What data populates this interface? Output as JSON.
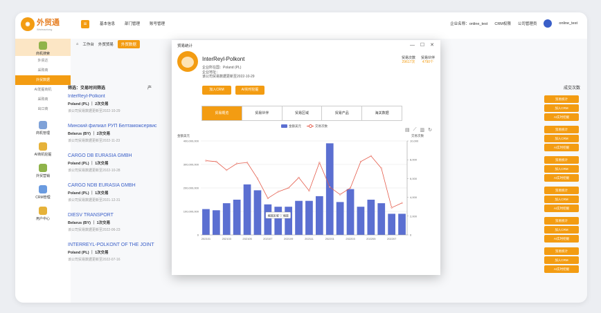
{
  "app": {
    "logo_text": "外贸通",
    "logo_sub": "Waimaotong",
    "menu_icon": "hamburger-icon",
    "topnav": [
      "基本信息",
      "部门管理",
      "账号管理"
    ],
    "company_label": "企业名称：online_test",
    "crm_label": "CRM权限",
    "manager_label": "公司管理员",
    "username": "online_test"
  },
  "sidebar": {
    "groups": [
      {
        "label": "商机搜索",
        "items": [
          "外贸达",
          "采购商",
          "外贸数据",
          "AI发掘商机",
          "采购商",
          "出口商"
        ]
      },
      {
        "label": "商机管理",
        "items": []
      },
      {
        "label": "AI商机挖掘",
        "items": []
      },
      {
        "label": "外贸营销",
        "items": []
      },
      {
        "label": "CRM管理",
        "items": []
      },
      {
        "label": "用户中心",
        "items": []
      }
    ]
  },
  "tabs": [
    "工作台",
    "外贸贸易",
    "外贸数据"
  ],
  "filter": {
    "label": "筛选：交易时间筛选",
    "label2": "产"
  },
  "companies": [
    {
      "name": "InterReyl-Polkont",
      "country": "Poland (PL) ｜ 2次交易",
      "date": "该公司贸易数据更新至2022-10-29"
    },
    {
      "name": "Минский филиал РУП Белтаможсервис",
      "country": "Belarus (BY) ｜ 2次交易",
      "date": "该公司贸易数据更新至2022-11-23"
    },
    {
      "name": "CARGO DB EURASIA GMBH",
      "country": "Poland (PL) ｜ 1次交易",
      "date": "该公司贸易数据更新至2022-10-28"
    },
    {
      "name": "CARGO NDB EURASIA GMBH",
      "country": "Poland (PL) ｜ 1次交易",
      "date": "该公司贸易数据更新至2021-12-31"
    },
    {
      "name": "DIESV TRANSPORT",
      "country": "Belarus (BY) ｜ 1次交易",
      "date": "该公司贸易数据更新至2022-06-23"
    },
    {
      "name": "INTERREYL-POLKONT OF THE JOINT",
      "country": "Poland (PL) ｜ 1次交易",
      "date": "该公司贸易数据更新至2022-07-16"
    }
  ],
  "right_header": "成交次数",
  "actions": [
    "贸易统计",
    "加入CRM",
    "AI实时挖掘"
  ],
  "modal": {
    "title": "贸易统计",
    "controls": "— ☐ ✕",
    "company": "InterReyl-Polkont",
    "info": [
      "企业所在国：Poland (PL)",
      "企业地址：",
      "该公司贸易数据更新至2022-10-29"
    ],
    "btn_crm": "加入CRM",
    "btn_ai": "AI实时挖掘",
    "stat1_label": "贸易次数",
    "stat1_value": "29617次",
    "stat2_label": "贸易伙伴",
    "stat2_value": "4790个",
    "tabs": [
      "贸易概览",
      "贸易伙伴",
      "贸易区域",
      "贸易产品",
      "海关数据"
    ]
  },
  "chart_data": {
    "type": "bar",
    "legend": [
      "金额美元",
      "交易次数"
    ],
    "ylabel_left": "金额美元",
    "ylabel_right": "交易次数",
    "x": [
      "202101",
      "202102",
      "202103",
      "202104",
      "202105",
      "202106",
      "202107",
      "202108",
      "202109",
      "202110",
      "202111",
      "202112",
      "202201",
      "202202",
      "202203",
      "202204",
      "202205",
      "202206",
      "202207",
      "202208"
    ],
    "x_labels": [
      "202101",
      "202103",
      "202105",
      "202107",
      "202109",
      "202111",
      "202201",
      "202203",
      "202205",
      "202207"
    ],
    "bars": [
      110000000,
      105000000,
      135000000,
      150000000,
      215000000,
      190000000,
      130000000,
      120000000,
      120000000,
      145000000,
      145000000,
      165000000,
      390000000,
      140000000,
      195000000,
      120000000,
      150000000,
      135000000,
      90000000,
      90000000
    ],
    "line": [
      7900,
      7800,
      6900,
      7600,
      7700,
      6000,
      3900,
      4600,
      5000,
      6100,
      4700,
      7700,
      5100,
      4300,
      5000,
      7800,
      8400,
      7100,
      2900,
      3400
    ],
    "ylim_left": [
      0,
      400000000
    ],
    "yticks_left": [
      "0",
      "100,000,000",
      "200,000,000",
      "300,000,000",
      "400,000,000"
    ],
    "ylim_right": [
      0,
      10000
    ],
    "yticks_right": [
      "0",
      "2,000",
      "4,000",
      "6,000",
      "8,000",
      "10,000"
    ],
    "tooltip": "缩放区域 ▽ 缩放"
  }
}
